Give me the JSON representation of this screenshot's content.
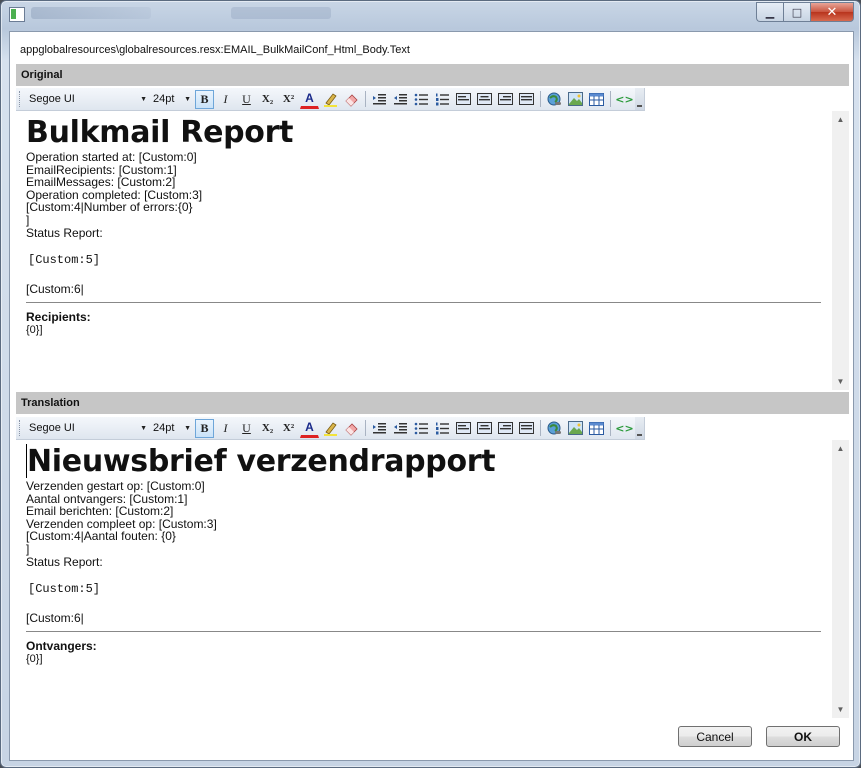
{
  "window": {
    "resource_path": "appglobalresources\\globalresources.resx:EMAIL_BulkMailConf_Html_Body.Text"
  },
  "toolbar": {
    "font_family": "Segoe UI",
    "font_size": "24pt",
    "bold_label": "B",
    "italic_label": "I",
    "underline_label": "U",
    "subscript_label": "X₂",
    "superscript_label": "X²",
    "font_color_label": "A",
    "icons": [
      "bold-icon",
      "italic-icon",
      "underline-icon",
      "subscript-icon",
      "superscript-icon",
      "font-color-icon",
      "highlight-icon",
      "eraser-icon",
      "indent-icon",
      "outdent-icon",
      "bullet-list-icon",
      "numbered-list-icon",
      "align-left-icon",
      "align-center-icon",
      "align-right-icon",
      "justify-icon",
      "hyperlink-icon",
      "image-icon",
      "table-icon",
      "source-code-icon"
    ]
  },
  "original": {
    "header": "Original",
    "title": "Bulkmail Report",
    "lines": [
      "Operation started at: [Custom:0]",
      "EmailRecipients: [Custom:1]",
      "EmailMessages: [Custom:2]",
      "Operation completed: [Custom:3]",
      "[Custom:4|Number of errors:{0}",
      "]",
      "Status Report:"
    ],
    "mono": "[Custom:5]",
    "custom6": "[Custom:6|",
    "recipients_label": "Recipients:",
    "recipients_value": "{0}]"
  },
  "translation": {
    "header": "Translation",
    "title": "Nieuwsbrief verzendrapport",
    "lines": [
      "Verzenden gestart op: [Custom:0]",
      "Aantal ontvangers: [Custom:1]",
      "Email berichten: [Custom:2]",
      "Verzenden compleet op: [Custom:3]",
      "[Custom:4|Aantal fouten: {0}",
      "]",
      "Status Report:"
    ],
    "mono": "[Custom:5]",
    "custom6": "[Custom:6|",
    "recipients_label": "Ontvangers:",
    "recipients_value": "{0}]"
  },
  "buttons": {
    "cancel": "Cancel",
    "ok": "OK"
  },
  "window_controls": {
    "minimize": "▁",
    "maximize": "□",
    "close": "✕"
  }
}
